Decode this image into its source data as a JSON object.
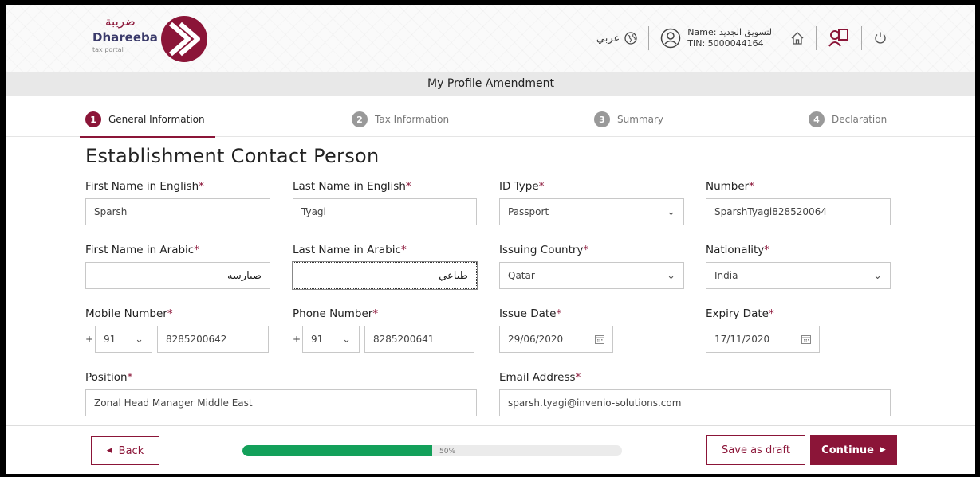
{
  "header": {
    "logo_arabic": "ضريبة",
    "logo_name": "Dhareeba",
    "logo_sub": "tax portal",
    "language_label": "عربي",
    "user_name_line": "Name: التسويق الجديد",
    "user_tin_line": "TIN: 5000044164"
  },
  "page_title": "My Profile Amendment",
  "steps": [
    {
      "number": "1",
      "label": "General Information",
      "active": true
    },
    {
      "number": "2",
      "label": "Tax Information",
      "active": false
    },
    {
      "number": "3",
      "label": "Summary",
      "active": false
    },
    {
      "number": "4",
      "label": "Declaration",
      "active": false
    }
  ],
  "section_title": "Establishment Contact Person",
  "required_mark": "*",
  "form": {
    "first_name_en": {
      "label": "First Name in English",
      "value": "Sparsh"
    },
    "last_name_en": {
      "label": "Last Name in English",
      "value": "Tyagi"
    },
    "id_type": {
      "label": "ID Type",
      "value": "Passport"
    },
    "id_number": {
      "label": "Number",
      "value": "SparshTyagi828520064"
    },
    "first_name_ar": {
      "label": "First Name in Arabic",
      "value": "صيارسه"
    },
    "last_name_ar": {
      "label": "Last Name in Arabic",
      "value": "طياعي"
    },
    "issuing_country": {
      "label": "Issuing Country",
      "value": "Qatar"
    },
    "nationality": {
      "label": "Nationality",
      "value": "India"
    },
    "mobile": {
      "label": "Mobile Number",
      "plus": "+",
      "code": "91",
      "value": "8285200642"
    },
    "phone": {
      "label": "Phone Number",
      "plus": "+",
      "code": "91",
      "value": "8285200641"
    },
    "issue_date": {
      "label": "Issue Date",
      "value": "29/06/2020"
    },
    "expiry_date": {
      "label": "Expiry Date",
      "value": "17/11/2020"
    },
    "position": {
      "label": "Position",
      "value": "Zonal Head Manager Middle East"
    },
    "email": {
      "label": "Email Address",
      "value": "sparsh.tyagi@invenio-solutions.com"
    }
  },
  "footer": {
    "back_label": "Back",
    "progress_percent": 50,
    "progress_label": "50%",
    "save_draft_label": "Save as draft",
    "continue_label": "Continue"
  },
  "colors": {
    "brand": "#8b1538",
    "progress": "#13a05a"
  }
}
